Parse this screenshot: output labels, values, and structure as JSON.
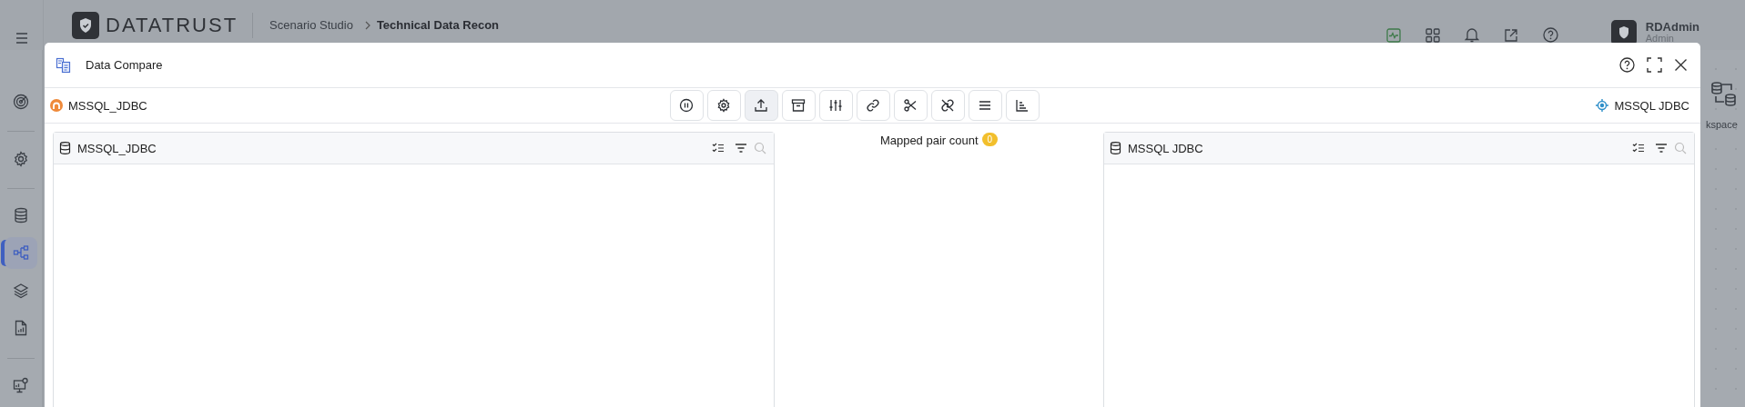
{
  "app": {
    "logo": "DATATRUST",
    "breadcrumb": [
      {
        "label": "Scenario Studio",
        "current": false
      },
      {
        "label": "Technical Data Recon",
        "current": true
      }
    ],
    "user": {
      "name": "RDAdmin",
      "role": "Admin"
    }
  },
  "sidebar": {
    "items": [
      {
        "selected": false
      },
      {
        "selected": false
      },
      {
        "selected": false
      },
      {
        "selected": true
      },
      {
        "selected": false
      },
      {
        "selected": false
      },
      {
        "selected": false
      }
    ]
  },
  "workspace": {
    "label": "kspace"
  },
  "dialog": {
    "title": "Data Compare",
    "source": "MSSQL_JDBC",
    "target": "MSSQL JDBC",
    "toolbar": [
      {
        "selected": false
      },
      {
        "selected": false
      },
      {
        "selected": true
      },
      {
        "selected": false
      },
      {
        "selected": false
      },
      {
        "selected": false
      },
      {
        "selected": false
      },
      {
        "selected": false
      },
      {
        "selected": false
      },
      {
        "selected": false
      }
    ],
    "left_panel": {
      "title": "MSSQL_JDBC"
    },
    "mapping": {
      "label": "Mapped pair count",
      "count": "0"
    },
    "right_panel": {
      "title": "MSSQL JDBC"
    }
  }
}
